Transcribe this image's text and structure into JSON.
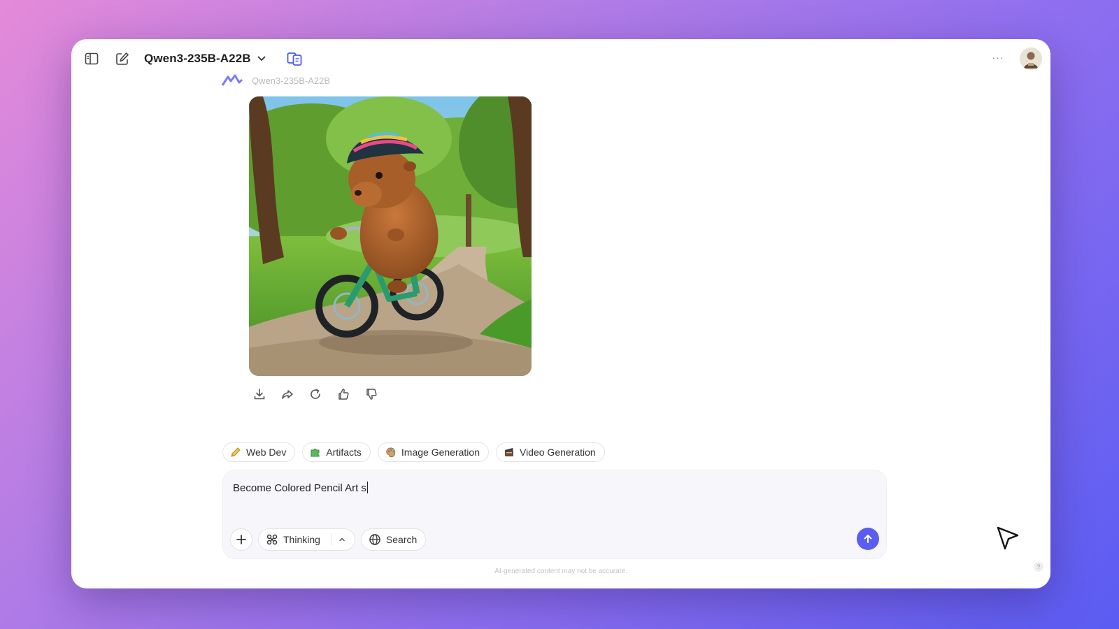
{
  "header": {
    "model_name": "Qwen3-235B-A22B",
    "more_label": "···"
  },
  "message": {
    "bot_name": "Qwen3-235B-A22B",
    "image_alt": "capybara wearing a helmet riding a green bicycle on a park path"
  },
  "chips": [
    {
      "label": "Web Dev",
      "icon": "pencil-icon"
    },
    {
      "label": "Artifacts",
      "icon": "puzzle-icon"
    },
    {
      "label": "Image Generation",
      "icon": "palette-icon"
    },
    {
      "label": "Video Generation",
      "icon": "film-icon"
    }
  ],
  "composer": {
    "input_value": "Become Colored Pencil Art s",
    "thinking_label": "Thinking",
    "search_label": "Search"
  },
  "footer": {
    "disclaimer": "AI-generated content may not be accurate.",
    "help_label": "?"
  },
  "colors": {
    "accent": "#5b5cf2",
    "model_switch_icon": "#4b5cf0"
  }
}
